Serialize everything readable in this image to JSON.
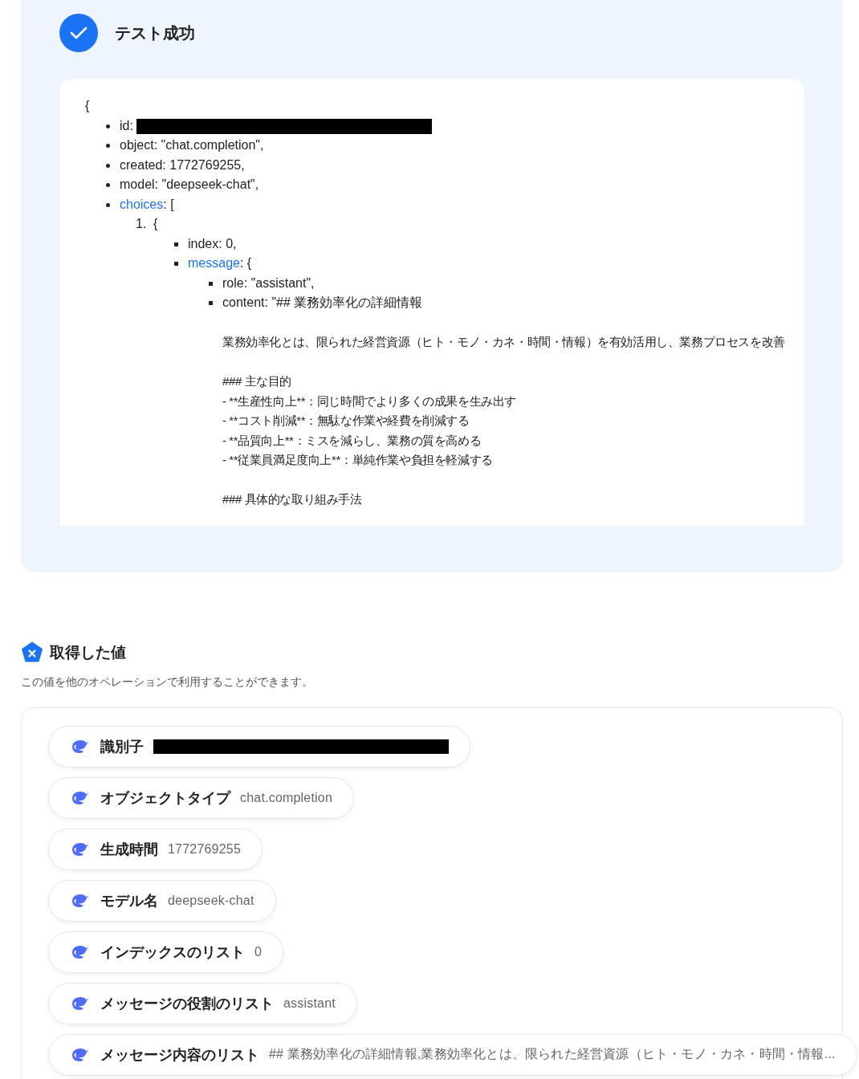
{
  "result": {
    "title": "テスト成功",
    "code": {
      "open": "{",
      "items": [
        {
          "kind": "redacted",
          "text": "id:"
        },
        {
          "kind": "plain",
          "text": "object: \"chat.completion\","
        },
        {
          "kind": "plain",
          "text": "created: 1772769255,"
        },
        {
          "kind": "plain",
          "text": "model: \"deepseek-chat\","
        },
        {
          "kind": "link",
          "key": "choices",
          "text": ": [",
          "entries": [
            {
              "marker": "1.",
              "text": "{",
              "items": [
                {
                  "kind": "plain",
                  "text": "index: 0,"
                },
                {
                  "kind": "link",
                  "key": "message",
                  "text": ": {",
                  "items": [
                    {
                      "kind": "plain",
                      "text": "role: \"assistant\","
                    },
                    {
                      "kind": "plain",
                      "text": "content: \"## 業務効率化の詳細情報",
                      "paragraphs": [
                        [
                          "業務効率化とは、限られた経営資源（ヒト・モノ・カネ・時間・情報）を有効活用し、業務プロセスを改善"
                        ],
                        [
                          "### 主な目的",
                          "- **生産性向上**：同じ時間でより多くの成果を生み出す",
                          "- **コスト削減**：無駄な作業や経費を削減する",
                          "- **品質向上**：ミスを減らし、業務の質を高める",
                          "- **従業員満足度向上**：単純作業や負担を軽減する"
                        ],
                        [
                          "### 具体的な取り組み手法"
                        ]
                      ]
                    }
                  ]
                }
              ]
            }
          ]
        }
      ]
    }
  },
  "values": {
    "title": "取得した値",
    "description": "この値を他のオペレーションで利用することができます。",
    "items": [
      {
        "kind": "redacted",
        "label": "識別子"
      },
      {
        "kind": "plain",
        "label": "オブジェクトタイプ",
        "value": "chat.completion"
      },
      {
        "kind": "plain",
        "label": "生成時間",
        "value": "1772769255"
      },
      {
        "kind": "plain",
        "label": "モデル名",
        "value": "deepseek-chat"
      },
      {
        "kind": "plain",
        "label": "インデックスのリスト",
        "value": "0"
      },
      {
        "kind": "plain",
        "label": "メッセージの役割のリスト",
        "value": "assistant"
      },
      {
        "kind": "plain",
        "label": "メッセージ内容のリスト",
        "value": "## 業務効率化の詳細情報,業務効率化とは、限られた経営資源（ヒト・モノ・カネ・時間・情報..."
      }
    ]
  }
}
